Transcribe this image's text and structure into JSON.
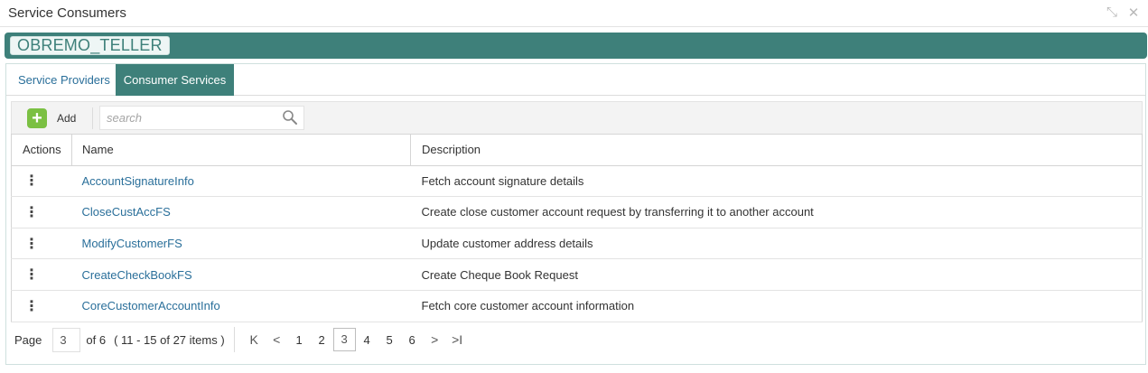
{
  "window": {
    "title": "Service Consumers"
  },
  "banner": {
    "label": "OBREMO_TELLER"
  },
  "tabs": [
    {
      "label": "Service Providers",
      "active": false
    },
    {
      "label": "Consumer Services",
      "active": true
    }
  ],
  "toolbar": {
    "add_label": "Add",
    "search_placeholder": "search"
  },
  "table": {
    "headers": {
      "actions": "Actions",
      "name": "Name",
      "description": "Description"
    },
    "rows": [
      {
        "action_icon": "⋮",
        "name": "AccountSignatureInfo",
        "description": "Fetch account signature details"
      },
      {
        "action_icon": "⋮",
        "name": "CloseCustAccFS",
        "description": "Create close customer account request by transferring it to another account"
      },
      {
        "action_icon": "⋮",
        "name": "ModifyCustomerFS",
        "description": "Update customer address details"
      },
      {
        "action_icon": "⋮",
        "name": "CreateCheckBookFS",
        "description": "Create Cheque Book Request"
      },
      {
        "action_icon": "⋮",
        "name": "CoreCustomerAccountInfo",
        "description": "Fetch core customer account information"
      }
    ]
  },
  "pager": {
    "page_label": "Page",
    "current_page": "3",
    "of_label": "of 6",
    "range_label": "( 11 - 15 of 27 items )",
    "first_icon": "K",
    "prev_icon": "<",
    "next_icon": ">",
    "last_icon": ">I",
    "pages": [
      "1",
      "2",
      "3",
      "4",
      "5",
      "6"
    ]
  },
  "colors": {
    "accent": "#3e807a",
    "link": "#2a6f9a",
    "add_green": "#7bc043"
  }
}
